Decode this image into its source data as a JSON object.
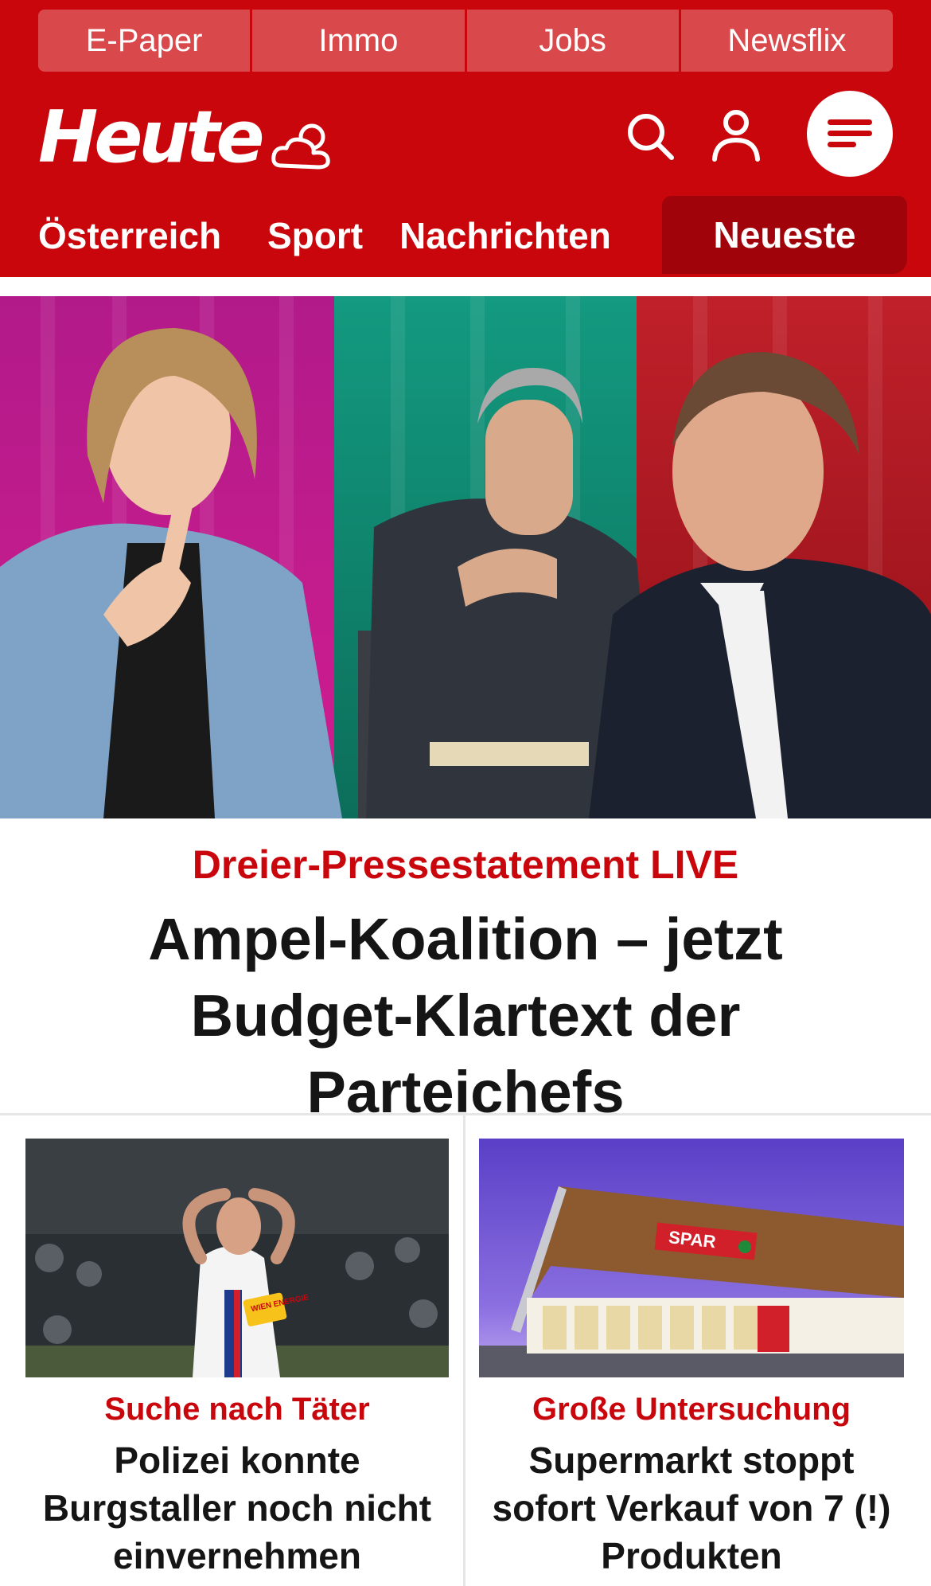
{
  "topbar": {
    "links": [
      "E-Paper",
      "Immo",
      "Jobs",
      "Newsflix"
    ]
  },
  "header": {
    "logo": "Heute",
    "weather_icon": "cloud-sun-icon",
    "search_icon": "search-icon",
    "user_icon": "user-icon",
    "menu_icon": "hamburger-menu-icon"
  },
  "nav": {
    "items": [
      "Österreich",
      "Sport",
      "Nachrichten"
    ],
    "active": "Neueste"
  },
  "hero": {
    "kicker": "Dreier-Pressestatement LIVE",
    "title": "Ampel-Koalition – jetzt Budget-Klartext der Parteichefs"
  },
  "articles": [
    {
      "kicker": "Suche nach Täter",
      "title": "Polizei konnte Burgstaller noch nicht einvernehmen",
      "jersey_text": "WIEN ENERGIE"
    },
    {
      "kicker": "Große Untersuchung",
      "title": "Supermarkt stoppt sofort Verkauf von 7 (!) Produkten",
      "store_sign": "SPAR"
    }
  ],
  "colors": {
    "brand_red": "#c8060c",
    "nav_active": "#a0040a",
    "topbar_button": "#d9494b"
  }
}
